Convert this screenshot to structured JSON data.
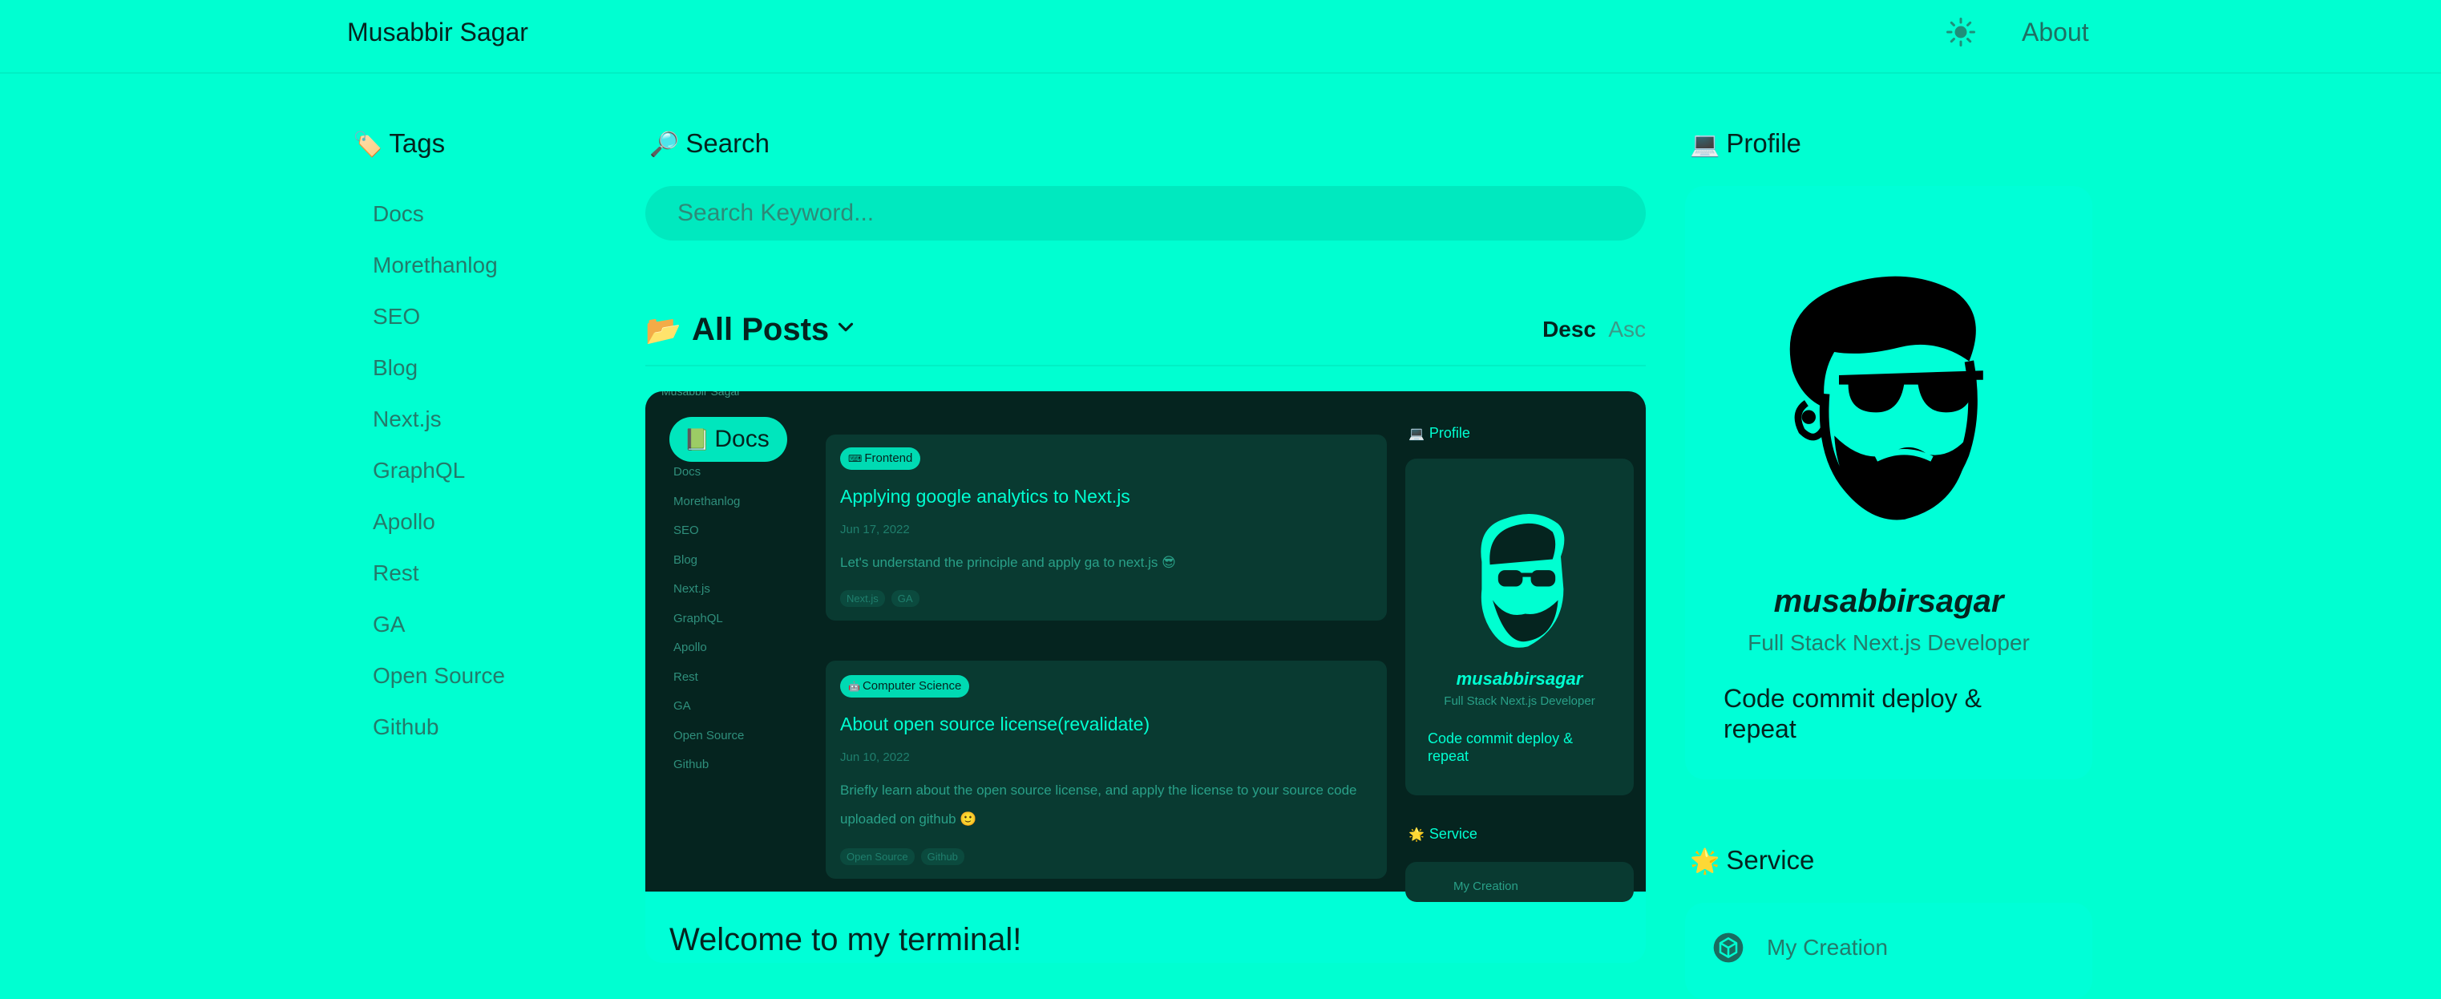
{
  "header": {
    "brand": "Musabbir Sagar",
    "about_link": "About",
    "theme_icon": "sun-icon"
  },
  "tags_section": {
    "heading": "Tags",
    "icon": "tag-icon",
    "items": [
      "Docs",
      "Morethanlog",
      "SEO",
      "Blog",
      "Next.js",
      "GraphQL",
      "Apollo",
      "Rest",
      "GA",
      "Open Source",
      "Github"
    ]
  },
  "search_section": {
    "heading": "Search",
    "icon": "magnifier-icon",
    "placeholder": "Search Keyword..."
  },
  "posts": {
    "heading": "All Posts",
    "icon": "open-folder-icon",
    "sort": {
      "desc": "Desc",
      "asc": "Asc",
      "selected": "Desc"
    },
    "featured": {
      "badge": "Docs",
      "badge_icon": "book-icon",
      "title": "Welcome to my terminal!",
      "thumbnail": {
        "top_left_text": "Musabbir Sagar",
        "tags": [
          "Docs",
          "Morethanlog",
          "SEO",
          "Blog",
          "Next.js",
          "GraphQL",
          "Apollo",
          "Rest",
          "GA",
          "Open Source",
          "Github"
        ],
        "posts": [
          {
            "category": "Frontend",
            "title": "Applying google analytics to Next.js",
            "date": "Jun 17, 2022",
            "summary": "Let's understand the principle and apply ga to next.js 😎",
            "tags": [
              "Next.js",
              "GA"
            ]
          },
          {
            "category": "Computer Science",
            "title": "About open source license(revalidate)",
            "date": "Jun 10, 2022",
            "summary": "Briefly learn about the open source license, and apply the license to your source code uploaded on github 🙂",
            "tags": [
              "Open Source",
              "Github"
            ]
          }
        ],
        "profile_heading": "Profile",
        "profile_name": "musabbirsagar",
        "profile_role": "Full Stack Next.js Developer",
        "profile_bio": "Code commit deploy & repeat",
        "service_heading": "Service",
        "service_item": "My Creation"
      }
    }
  },
  "profile": {
    "heading": "Profile",
    "icon": "laptop-icon",
    "name": "musabbirsagar",
    "role": "Full Stack Next.js Developer",
    "bio": "Code commit deploy & repeat"
  },
  "service": {
    "heading": "Service",
    "icon": "sparkle-icon",
    "items": [
      {
        "label": "My Creation",
        "icon": "cube-icon"
      }
    ]
  },
  "colors": {
    "background": "#00ffd1",
    "card": "#00ffd7",
    "text": "#05241f",
    "muted": "#247a6a",
    "thumbnail_bg": "#05241f"
  }
}
